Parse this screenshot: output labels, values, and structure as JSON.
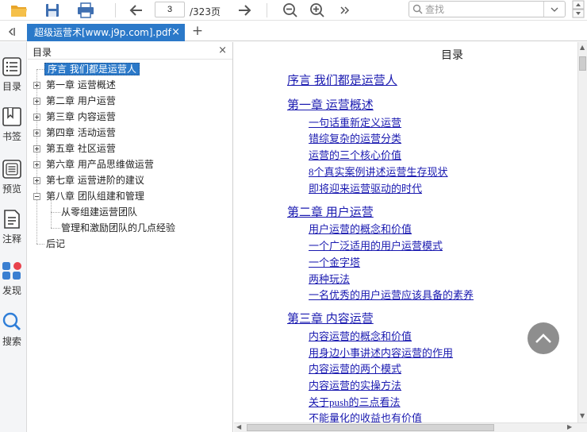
{
  "toolbar": {
    "page_current": "3",
    "page_total": "/323页",
    "search_placeholder": "查找"
  },
  "tab": {
    "title": "超级运营术[www.j9p.com].pdf",
    "close": "×",
    "add": "+"
  },
  "rail": [
    {
      "label": "目录",
      "icon": "toc-icon"
    },
    {
      "label": "书签",
      "icon": "bookmark-icon"
    },
    {
      "label": "预览",
      "icon": "preview-icon"
    },
    {
      "label": "注释",
      "icon": "annotation-icon"
    },
    {
      "label": "发现",
      "icon": "discover-icon"
    },
    {
      "label": "搜索",
      "icon": "search-icon"
    }
  ],
  "outline": {
    "title": "目录",
    "close": "×",
    "items": [
      {
        "label": "序言 我们都是运营人",
        "level": 0,
        "expander": "none",
        "selected": true
      },
      {
        "label": "第一章 运营概述",
        "level": 0,
        "expander": "plus"
      },
      {
        "label": "第二章 用户运营",
        "level": 0,
        "expander": "plus"
      },
      {
        "label": "第三章 内容运营",
        "level": 0,
        "expander": "plus"
      },
      {
        "label": "第四章 活动运营",
        "level": 0,
        "expander": "plus"
      },
      {
        "label": "第五章 社区运营",
        "level": 0,
        "expander": "plus"
      },
      {
        "label": "第六章 用产品思维做运营",
        "level": 0,
        "expander": "plus"
      },
      {
        "label": "第七章 运营进阶的建议",
        "level": 0,
        "expander": "plus"
      },
      {
        "label": "第八章 团队组建和管理",
        "level": 0,
        "expander": "minus"
      },
      {
        "label": "从零组建运营团队",
        "level": 1,
        "expander": "none"
      },
      {
        "label": "管理和激励团队的几点经验",
        "level": 1,
        "expander": "none"
      },
      {
        "label": "后记",
        "level": 0,
        "expander": "none"
      }
    ]
  },
  "document": {
    "title": "目录",
    "toc": [
      {
        "text": "序言 我们都是运营人",
        "kind": "chap"
      },
      {
        "text": "第一章 运营概述",
        "kind": "chap"
      },
      {
        "text": "一句话重新定义运营",
        "kind": "sec"
      },
      {
        "text": "错综复杂的运营分类",
        "kind": "sec"
      },
      {
        "text": "运营的三个核心价值",
        "kind": "sec"
      },
      {
        "text": "8个真实案例讲述运营生存现状",
        "kind": "sec"
      },
      {
        "text": "即将迎来运营驱动的时代",
        "kind": "sec"
      },
      {
        "text": "第二章 用户运营",
        "kind": "chap"
      },
      {
        "text": "用户运营的概念和价值",
        "kind": "sec"
      },
      {
        "text": "一个广泛适用的用户运营模式",
        "kind": "sec"
      },
      {
        "text": "一个金字塔",
        "kind": "sec"
      },
      {
        "text": "两种玩法",
        "kind": "sec"
      },
      {
        "text": "一名优秀的用户运营应该具备的素养",
        "kind": "sec"
      },
      {
        "text": "第三章 内容运营",
        "kind": "chap"
      },
      {
        "text": "内容运营的概念和价值",
        "kind": "sec"
      },
      {
        "text": "用身边小事讲述内容运营的作用",
        "kind": "sec"
      },
      {
        "text": "内容运营的两个模式",
        "kind": "sec"
      },
      {
        "text": "内容运营的实操方法",
        "kind": "sec"
      },
      {
        "text": "关于push的三点看法",
        "kind": "sec"
      },
      {
        "text": "不能量化的收益也有价值",
        "kind": "sec"
      }
    ]
  }
}
